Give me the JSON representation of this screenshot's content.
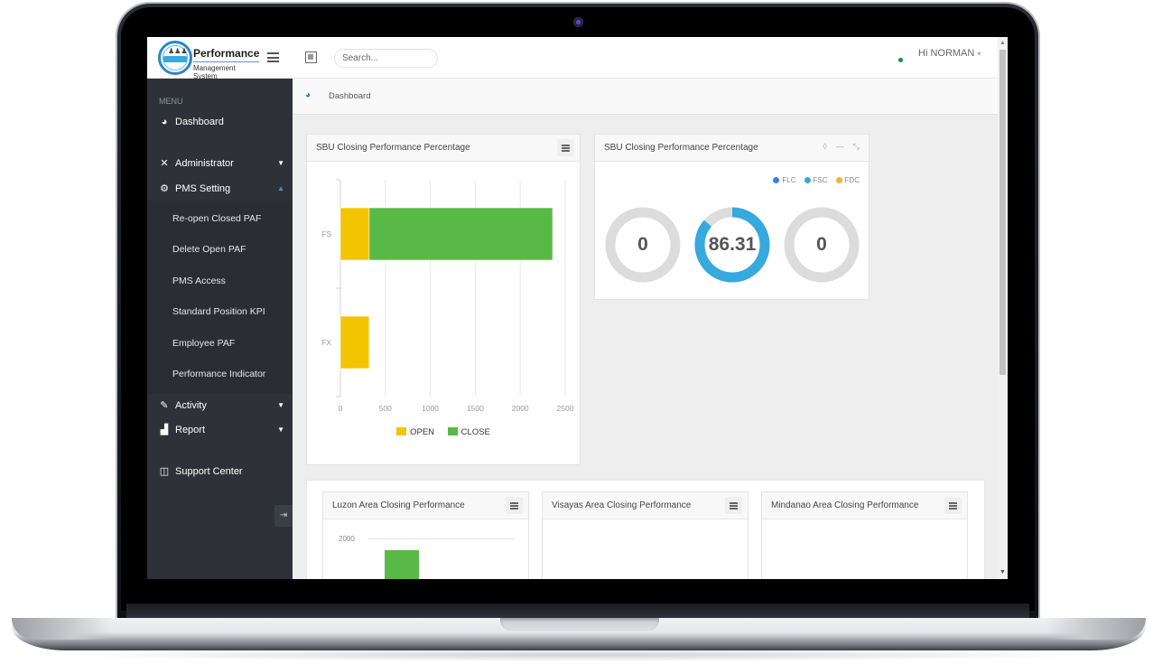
{
  "app": {
    "logo_title": "Performance",
    "logo_subtitle": "Management System",
    "logo_band_text": "Performance"
  },
  "topbar": {
    "search_placeholder": "Search...",
    "user_greeting": "Hi NORMAN",
    "user_caret": "▾",
    "online_status_color": "#1a8f3c"
  },
  "sidebar": {
    "menu_label": "MENU",
    "items": [
      {
        "label": "Dashboard",
        "icon": "dashboard-icon",
        "glyph": "◕"
      },
      {
        "label": "Administrator",
        "icon": "tools-icon",
        "glyph": "✕",
        "arrow": "▼"
      },
      {
        "label": "PMS Setting",
        "icon": "gears-icon",
        "glyph": "⚙",
        "arrow": "▲",
        "expanded": true
      },
      {
        "label": "Activity",
        "icon": "edit-icon",
        "glyph": "✎",
        "arrow": "▼"
      },
      {
        "label": "Report",
        "icon": "bar-chart-icon",
        "glyph": "▟",
        "arrow": "▼"
      },
      {
        "label": "Support Center",
        "icon": "book-icon",
        "glyph": "◫"
      }
    ],
    "submenu": [
      "Re-open Closed PAF",
      "Delete Open PAF",
      "PMS Access",
      "Standard Position KPI",
      "Employee PAF",
      "Performance Indicator"
    ],
    "collapse_glyph": "⇥"
  },
  "breadcrumb": {
    "home_glyph": "◕",
    "current": "Dashboard"
  },
  "panels": {
    "bar_panel_title": "SBU Closing Performance Percentage",
    "donut_panel_title": "SBU Closing Performance Percentage",
    "donut_tools": [
      "◊",
      "—",
      "⤡"
    ],
    "luzon_title": "Luzon Area Closing Performance",
    "visayas_title": "Visayas Area Closing Performance",
    "mindanao_title": "Mindanao Area Closing Performance"
  },
  "colors": {
    "open": "#f2c500",
    "close": "#58b947",
    "flc": "#3c7fdc",
    "fsc": "#36a9dd",
    "fdc": "#f4b13d",
    "donut_track": "#dcdcdc"
  },
  "chart_data": [
    {
      "type": "bar",
      "orientation": "horizontal",
      "stacked": true,
      "title": "SBU Closing Performance Percentage",
      "categories": [
        "FS",
        "FX"
      ],
      "series": [
        {
          "name": "OPEN",
          "values": [
            320,
            320
          ]
        },
        {
          "name": "CLOSE",
          "values": [
            2040,
            0
          ]
        }
      ],
      "xlim": [
        0,
        2500
      ],
      "xticks": [
        0,
        500,
        1000,
        1500,
        2000,
        2500
      ],
      "grid": true,
      "legend": "bottom"
    },
    {
      "type": "pie",
      "variant": "donut-gauges",
      "title": "SBU Closing Performance Percentage",
      "legend": "top-right",
      "items": [
        {
          "name": "FLC",
          "value": 0,
          "max": 100
        },
        {
          "name": "FSC",
          "value": 86.31,
          "max": 100
        },
        {
          "name": "FDC",
          "value": 0,
          "max": 100
        }
      ]
    },
    {
      "type": "bar",
      "title": "Luzon Area Closing Performance",
      "yticks_visible": [
        2000
      ],
      "note": "chart partially visible (cut off by viewport)"
    }
  ]
}
